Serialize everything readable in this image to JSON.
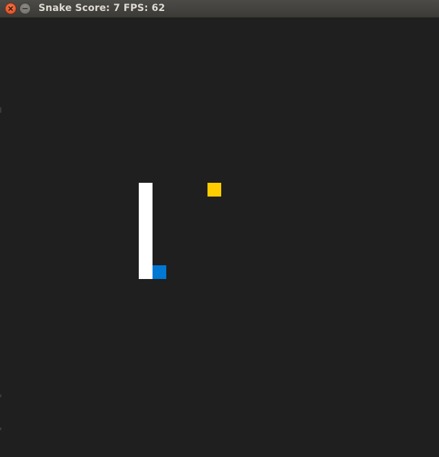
{
  "window": {
    "title": "Snake Score: 7 FPS: 62",
    "close_icon": "close-icon",
    "minimize_icon": "minimize-icon"
  },
  "game": {
    "score": 7,
    "fps": 62,
    "colors": {
      "background": "#1f1f1f",
      "snake_body": "#ffffff",
      "snake_head": "#0078d4",
      "food": "#ffcc00"
    },
    "grid": {
      "cols": 32,
      "rows": 32
    },
    "food": {
      "col": 15,
      "row": 12
    },
    "snake": [
      {
        "col": 11,
        "row": 18,
        "part": "head"
      },
      {
        "col": 10,
        "row": 18,
        "part": "body"
      },
      {
        "col": 10,
        "row": 17,
        "part": "body"
      },
      {
        "col": 10,
        "row": 16,
        "part": "body"
      },
      {
        "col": 10,
        "row": 15,
        "part": "body"
      },
      {
        "col": 10,
        "row": 14,
        "part": "body"
      },
      {
        "col": 10,
        "row": 13,
        "part": "body"
      },
      {
        "col": 10,
        "row": 12,
        "part": "body"
      }
    ]
  }
}
